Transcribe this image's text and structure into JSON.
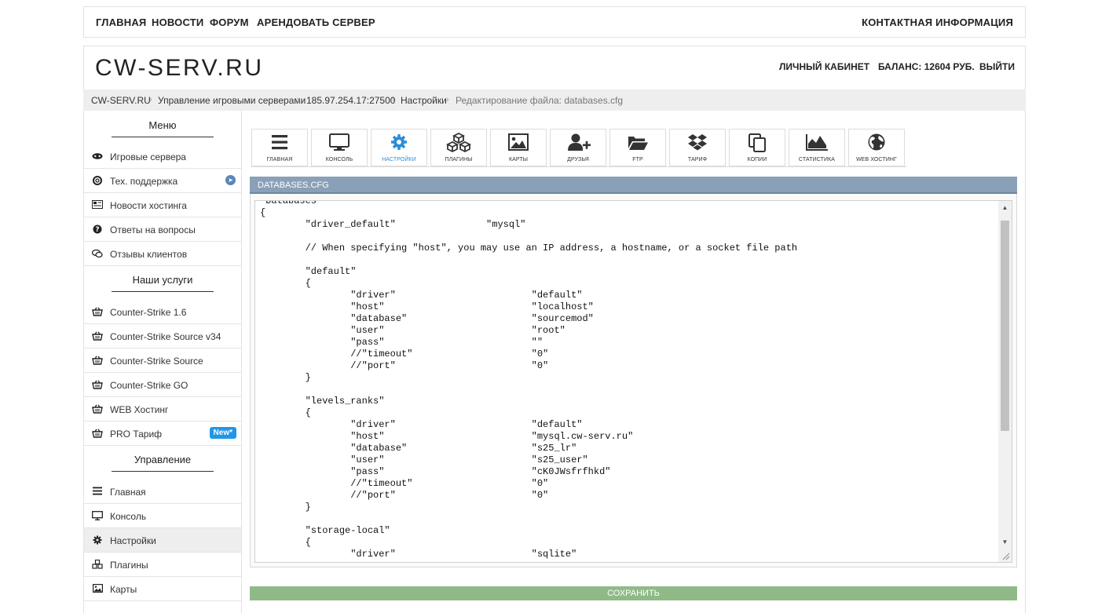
{
  "topnav": {
    "main": "ГЛАВНАЯ",
    "news": "НОВОСТИ",
    "forum": "ФОРУМ",
    "rent": "АРЕНДОВАТЬ СЕРВЕР",
    "contacts": "КОНТАКТНАЯ ИНФОРМАЦИЯ"
  },
  "header": {
    "logo": "CW-SERV.RU",
    "cabinet": "ЛИЧНЫЙ КАБИНЕТ",
    "balance": "БАЛАНС: 12604 РУБ.",
    "logout": "ВЫЙТИ"
  },
  "breadcrumb": {
    "items": [
      "CW-SERV.RU",
      "Управление игровыми серверами",
      "185.97.254.17:27500",
      "Настройки"
    ],
    "current": "Редактирование файла: databases.cfg",
    "separator": "›"
  },
  "sidebar": {
    "menu_heading": "Меню",
    "menu": [
      {
        "label": "Игровые сервера",
        "icon": "gamepad-icon"
      },
      {
        "label": "Тех. поддержка",
        "icon": "lifebuoy-icon",
        "tag": "telegram-icon"
      },
      {
        "label": "Новости хостинга",
        "icon": "newspaper-icon"
      },
      {
        "label": "Ответы на вопросы",
        "icon": "question-icon"
      },
      {
        "label": "Отзывы клиентов",
        "icon": "comments-icon"
      }
    ],
    "services_heading": "Наши услуги",
    "services": [
      {
        "label": "Counter-Strike 1.6",
        "icon": "basket-icon"
      },
      {
        "label": "Counter-Strike Source v34",
        "icon": "basket-icon"
      },
      {
        "label": "Counter-Strike Source",
        "icon": "basket-icon"
      },
      {
        "label": "Counter-Strike GO",
        "icon": "basket-icon"
      },
      {
        "label": "WEB Хостинг",
        "icon": "basket-icon"
      },
      {
        "label": "PRO Тариф",
        "icon": "basket-icon",
        "badge": "New*"
      }
    ],
    "manage_heading": "Управление",
    "manage": [
      {
        "label": "Главная",
        "icon": "bars-icon"
      },
      {
        "label": "Консоль",
        "icon": "monitor-icon"
      },
      {
        "label": "Настройки",
        "icon": "gear-icon",
        "active": true
      },
      {
        "label": "Плагины",
        "icon": "cubes-icon"
      },
      {
        "label": "Карты",
        "icon": "image-icon"
      }
    ]
  },
  "toolbar": {
    "buttons": [
      {
        "label": "главная",
        "icon": "bars-icon"
      },
      {
        "label": "консоль",
        "icon": "monitor-icon"
      },
      {
        "label": "настройки",
        "icon": "gear-icon",
        "active": true
      },
      {
        "label": "плагины",
        "icon": "cubes-icon"
      },
      {
        "label": "карты",
        "icon": "image-icon"
      },
      {
        "label": "друзья",
        "icon": "user-plus-icon"
      },
      {
        "label": "ftp",
        "icon": "folder-open-icon"
      },
      {
        "label": "тариф",
        "icon": "dropbox-icon"
      },
      {
        "label": "копии",
        "icon": "copy-icon"
      },
      {
        "label": "статистика",
        "icon": "area-chart-icon"
      },
      {
        "label": "web хостинг",
        "icon": "globe-icon"
      }
    ]
  },
  "file": {
    "title": "DATABASES.CFG",
    "content": "\"Databases\"\n{\n\t\"driver_default\"\t\t\"mysql\"\n\n\t// When specifying \"host\", you may use an IP address, a hostname, or a socket file path\n\n\t\"default\"\n\t{\n\t\t\"driver\"\t\t\t\"default\"\n\t\t\"host\"\t\t\t\t\"localhost\"\n\t\t\"database\"\t\t\t\"sourcemod\"\n\t\t\"user\"\t\t\t\t\"root\"\n\t\t\"pass\"\t\t\t\t\"\"\n\t\t//\"timeout\"\t\t\t\"0\"\n\t\t//\"port\"\t\t\t\"0\"\n\t}\n\n\t\"levels_ranks\"\n\t{\n\t\t\"driver\"\t\t\t\"default\"\n\t\t\"host\"\t\t\t\t\"mysql.cw-serv.ru\"\n\t\t\"database\"\t\t\t\"s25_lr\"\n\t\t\"user\"\t\t\t\t\"s25_user\"\n\t\t\"pass\"\t\t\t\t\"cK0JWsfrfhkd\"\n\t\t//\"timeout\"\t\t\t\"0\"\n\t\t//\"port\"\t\t\t\"0\"\n\t}\n\n\t\"storage-local\"\n\t{\n\t\t\"driver\"\t\t\t\"sqlite\""
  },
  "save_label": "СОХРАНИТЬ",
  "colors": {
    "accent": "#2b8ed6",
    "filebar": "#8aa0b8",
    "save": "#8fba87",
    "badge": "#2196e8"
  }
}
